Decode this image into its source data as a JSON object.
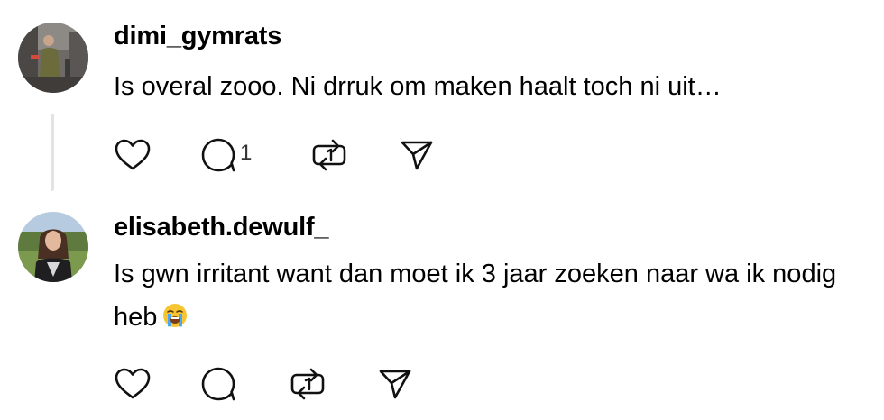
{
  "posts": [
    {
      "username": "dimi_gymrats",
      "text": "Is overal zooo. Ni drruk om maken haalt toch ni uit…",
      "reply_count": "1",
      "icons": [
        "heart-icon",
        "comment-icon",
        "repost-icon",
        "share-icon"
      ]
    },
    {
      "username": "elisabeth.dewulf_",
      "text": "Is gwn irritant want dan moet ik 3 jaar zoeken naar wa ik nodig heb",
      "emoji": "loudly-crying-face",
      "icons": [
        "heart-icon",
        "comment-icon",
        "repost-icon",
        "share-icon"
      ]
    }
  ],
  "colors": {
    "text": "#000000",
    "thread_line": "#e3e3e3",
    "icon_stroke": "#111111"
  }
}
